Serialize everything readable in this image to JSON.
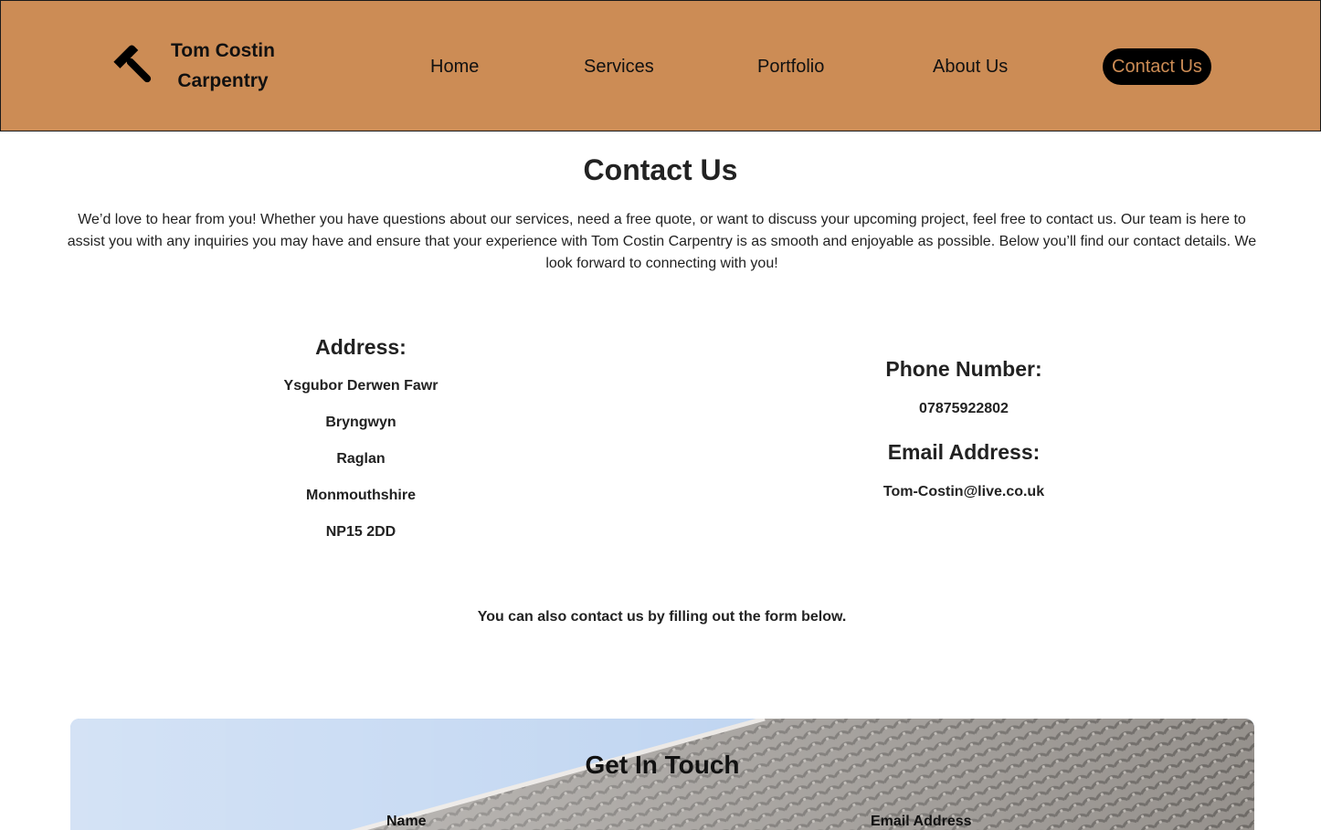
{
  "header": {
    "brand_line1": "Tom Costin",
    "brand_line2": "Carpentry",
    "logo_icon": "hammer-icon",
    "nav": [
      {
        "label": "Home"
      },
      {
        "label": "Services"
      },
      {
        "label": "Portfolio"
      },
      {
        "label": "About Us"
      },
      {
        "label": "Contact Us"
      }
    ],
    "active_nav": "Contact Us"
  },
  "main": {
    "title": "Contact Us",
    "intro": "We’d love to hear from you! Whether you have questions about our services, need a free quote, or want to discuss your upcoming project, feel free to contact us. Our team is here to assist you with any inquiries you may have and ensure that your experience with Tom Costin Carpentry is as smooth and enjoyable as possible. Below you’ll find our contact details. We look forward to connecting with you!",
    "address": {
      "heading": "Address:",
      "lines": [
        "Ysgubor Derwen Fawr",
        "Bryngwyn",
        "Raglan",
        "Monmouthshire",
        "NP15 2DD"
      ]
    },
    "phone": {
      "heading": "Phone Number:",
      "value": "07875922802"
    },
    "email": {
      "heading": "Email Address:",
      "value": "Tom-Costin@live.co.uk"
    },
    "form_note": "You can also contact us by filling out the form below."
  },
  "contact_form": {
    "title": "Get In Touch",
    "name_label": "Name",
    "email_label": "Email Address",
    "background": "roof-tiles-image"
  },
  "colors": {
    "header_bg": "#cc8c55",
    "active_nav_bg": "#000000",
    "active_nav_text": "#cc8c55",
    "text": "#222222"
  }
}
